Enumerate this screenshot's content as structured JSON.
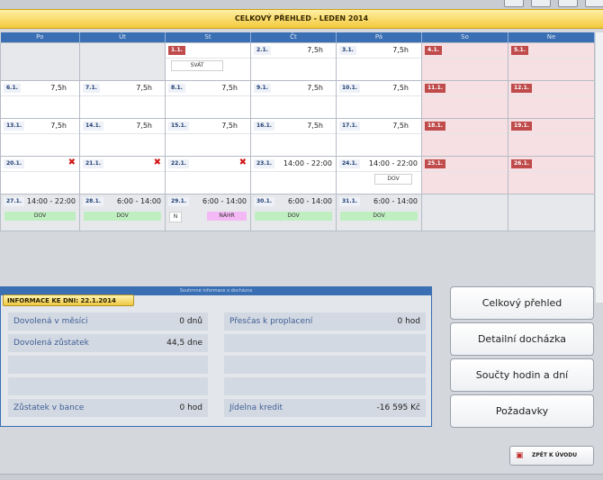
{
  "title": "CELKOVÝ PŘEHLED - LEDEN 2014",
  "days": [
    "Po",
    "Út",
    "St",
    "Čt",
    "Pá",
    "So",
    "Ne"
  ],
  "weeks": [
    [
      {
        "date": "",
        "empty": true
      },
      {
        "date": "",
        "empty": true
      },
      {
        "date": "1.1.",
        "red": true,
        "tag": "SVÁT",
        "tagType": "svat"
      },
      {
        "date": "2.1.",
        "hours": "7,5h"
      },
      {
        "date": "3.1.",
        "hours": "7,5h"
      },
      {
        "date": "4.1.",
        "red": true,
        "weekend": true
      },
      {
        "date": "5.1.",
        "red": true,
        "weekend": true
      }
    ],
    [
      {
        "date": "6.1.",
        "hours": "7,5h"
      },
      {
        "date": "7.1.",
        "hours": "7,5h"
      },
      {
        "date": "8.1.",
        "hours": "7,5h"
      },
      {
        "date": "9.1.",
        "hours": "7,5h"
      },
      {
        "date": "10.1.",
        "hours": "7,5h"
      },
      {
        "date": "11.1.",
        "red": true,
        "weekend": true
      },
      {
        "date": "12.1.",
        "red": true,
        "weekend": true
      }
    ],
    [
      {
        "date": "13.1.",
        "hours": "7,5h"
      },
      {
        "date": "14.1.",
        "hours": "7,5h"
      },
      {
        "date": "15.1.",
        "hours": "7,5h"
      },
      {
        "date": "16.1.",
        "hours": "7,5h"
      },
      {
        "date": "17.1.",
        "hours": "7,5h"
      },
      {
        "date": "18.1.",
        "red": true,
        "weekend": true
      },
      {
        "date": "19.1.",
        "red": true,
        "weekend": true
      }
    ],
    [
      {
        "date": "20.1.",
        "x": true
      },
      {
        "date": "21.1.",
        "x": true
      },
      {
        "date": "22.1.",
        "x": true
      },
      {
        "date": "23.1.",
        "hours": "14:00 - 22:00"
      },
      {
        "date": "24.1.",
        "hours": "14:00 - 22:00",
        "tag": "DOV",
        "tagType": "dovsm"
      },
      {
        "date": "25.1.",
        "red": true,
        "weekend": true
      },
      {
        "date": "26.1.",
        "red": true,
        "weekend": true
      }
    ],
    [
      {
        "date": "27.1.",
        "hours": "14:00 - 22:00",
        "tag": "DOV",
        "tagType": "dov",
        "grey": true
      },
      {
        "date": "28.1.",
        "hours": "6:00 - 14:00",
        "tag": "DOV",
        "tagType": "dov",
        "grey": true
      },
      {
        "date": "29.1.",
        "hours": "6:00 - 14:00",
        "tag": "NÁHR",
        "tagType": "nahr",
        "tag2": "N",
        "grey": true
      },
      {
        "date": "30.1.",
        "hours": "6:00 - 14:00",
        "tag": "DOV",
        "tagType": "dov",
        "grey": true
      },
      {
        "date": "31.1.",
        "hours": "6:00 - 14:00",
        "tag": "DOV",
        "tagType": "dov",
        "grey": true
      },
      {
        "date": "",
        "empty": true
      },
      {
        "date": "",
        "empty": true
      }
    ]
  ],
  "info": {
    "header": "Souhrnné informace o docházce",
    "tab": "INFORMACE KE DNI: 22.1.2014",
    "left": [
      {
        "label": "Dovolená v měsíci",
        "value": "0 dnů"
      },
      {
        "label": "Dovolená zůstatek",
        "value": "44,5 dne"
      },
      {
        "label": "",
        "value": ""
      },
      {
        "label": "",
        "value": ""
      },
      {
        "label": "Zůstatek v bance",
        "value": "0 hod"
      }
    ],
    "right": [
      {
        "label": "Přesčas k proplacení",
        "value": "0 hod"
      },
      {
        "label": "",
        "value": ""
      },
      {
        "label": "",
        "value": ""
      },
      {
        "label": "",
        "value": ""
      },
      {
        "label": "Jídelna kredit",
        "value": "-16 595 Kč"
      }
    ]
  },
  "buttons": {
    "overview": "Celkový přehled",
    "detail": "Detailní docházka",
    "sums": "Součty hodin a dní",
    "requests": "Požadavky",
    "back": "ZPĚT K ÚVODU"
  }
}
